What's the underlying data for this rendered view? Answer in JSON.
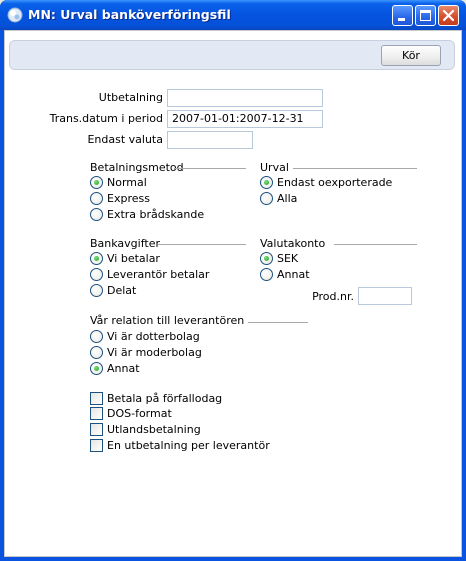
{
  "window": {
    "title": "MN: Urval banköverföringsfil",
    "icon": "app-bubble-icon",
    "controls": [
      "minimize-icon",
      "maximize-icon",
      "close-icon"
    ]
  },
  "toolbar": {
    "run_label": "Kör"
  },
  "fields": {
    "utbetalning": {
      "label": "Utbetalning",
      "value": ""
    },
    "period": {
      "label": "Trans.datum i period",
      "value": "2007-01-01:2007-12-31"
    },
    "valuta": {
      "label": "Endast valuta",
      "value": ""
    }
  },
  "betalningsmetod": {
    "label": "Betalningsmetod",
    "options": [
      "Normal",
      "Express",
      "Extra brådskande"
    ],
    "selected": "Normal"
  },
  "urval": {
    "label": "Urval",
    "options": [
      "Endast oexporterade",
      "Alla"
    ],
    "selected": "Endast oexporterade"
  },
  "bankavgifter": {
    "label": "Bankavgifter",
    "options": [
      "Vi betalar",
      "Leverantör betalar",
      "Delat"
    ],
    "selected": "Vi betalar"
  },
  "valutakonto": {
    "label": "Valutakonto",
    "options": [
      "SEK",
      "Annat"
    ],
    "selected": "SEK",
    "prodnr_label": "Prod.nr.",
    "prodnr_value": ""
  },
  "relation": {
    "label": "Vår relation till leverantören",
    "options": [
      "Vi är dotterbolag",
      "Vi är moderbolag",
      "Annat"
    ],
    "selected": "Annat"
  },
  "checkboxes": [
    {
      "label": "Betala på förfallodag",
      "checked": false
    },
    {
      "label": "DOS-format",
      "checked": false
    },
    {
      "label": "Utlandsbetalning",
      "checked": false
    },
    {
      "label": "En utbetalning per leverantör",
      "checked": false
    }
  ],
  "colors": {
    "titlebar": "#0553e0",
    "toolbar_bg": "#e2e9f4",
    "radio_dot": "#1f9b1f",
    "control_border": "#1c5180"
  }
}
